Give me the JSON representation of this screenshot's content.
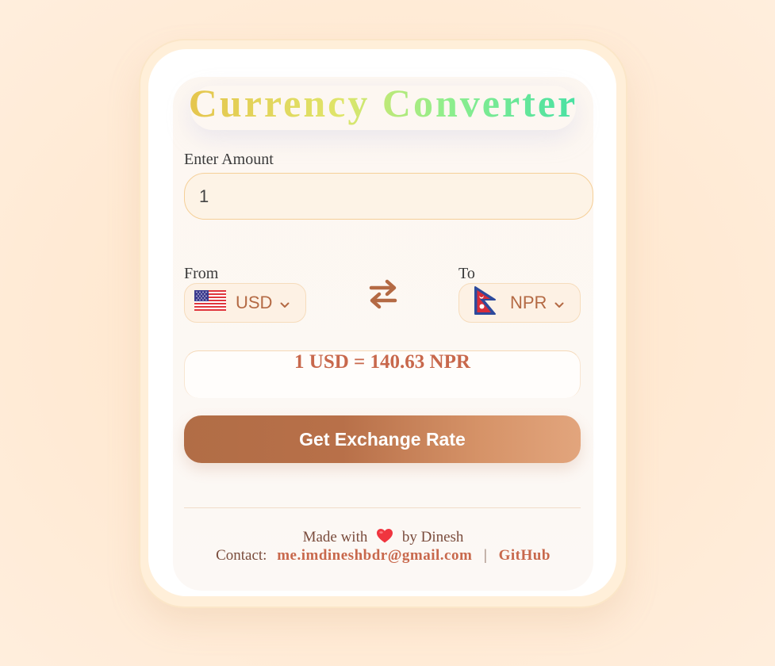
{
  "title": "Currency Converter",
  "amount": {
    "label": "Enter Amount",
    "value": "1"
  },
  "from": {
    "label": "From",
    "currency": "USD",
    "flag_icon": "us-flag-icon"
  },
  "to": {
    "label": "To",
    "currency": "NPR",
    "flag_icon": "nepal-flag-icon"
  },
  "swap_icon": "swap-arrows-icon",
  "result": "1 USD = 140.63 NPR",
  "button_label": "Get Exchange Rate",
  "footer": {
    "made_with": "Made with",
    "by": "by Dinesh",
    "contact_label": "Contact:",
    "email": "me.imdineshbdr@gmail.com",
    "separator": "|",
    "github": "GitHub"
  },
  "colors": {
    "accent": "#b46a44",
    "result": "#c8684c",
    "background": "#ffedd9"
  }
}
